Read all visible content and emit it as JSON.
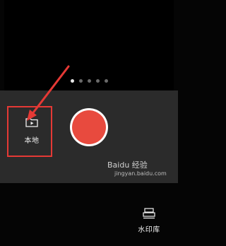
{
  "pager": {
    "count": 5,
    "active_index": 0
  },
  "toolbar": {
    "local_label": "本地",
    "watermark_label": "水印库",
    "shutter_color": "#e84a3e"
  },
  "annotation": {
    "color": "#e53935"
  },
  "watermark": {
    "brand": "Baidu 经验",
    "url": "jingyan.baidu.com"
  }
}
